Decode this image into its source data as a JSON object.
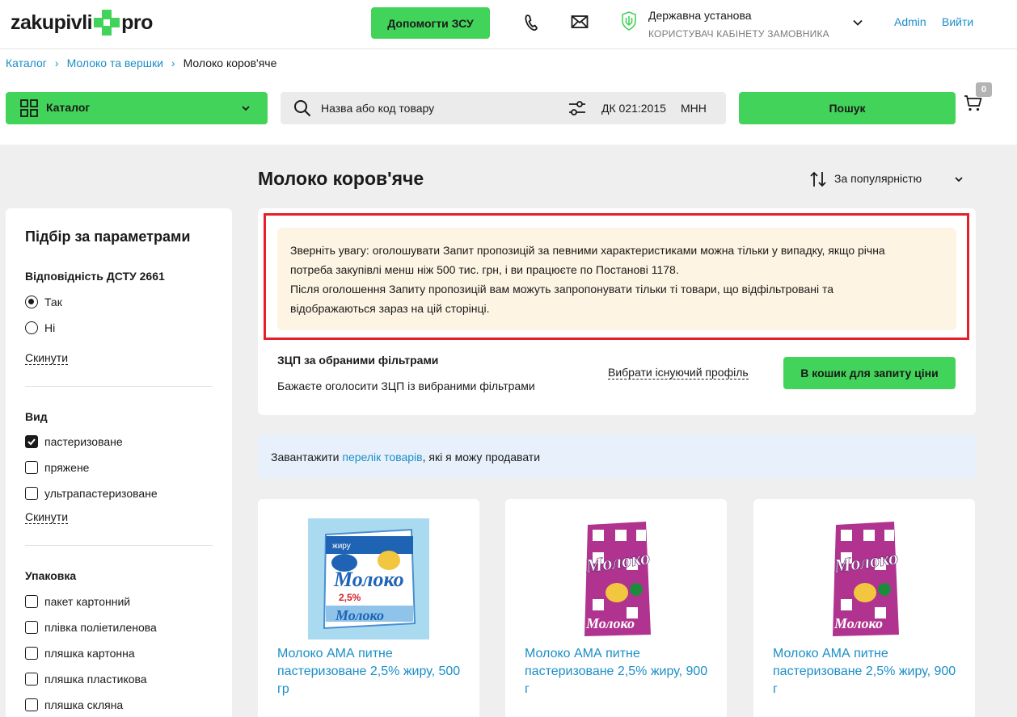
{
  "header": {
    "logo_left": "zakupivli",
    "logo_right": "pro",
    "help_button": "Допомогти ЗСУ",
    "org_name": "Державна установа",
    "org_role": "КОРИСТУВАЧ КАБІНЕТУ ЗАМОВНИКА",
    "admin_link": "Admin",
    "exit_link": "Вийти"
  },
  "breadcrumb": {
    "items": [
      "Каталог",
      "Молоко та вершки"
    ],
    "current": "Молоко коров'яче"
  },
  "search": {
    "catalog_label": "Каталог",
    "placeholder": "Назва або код товару",
    "option_dk": "ДК 021:2015",
    "option_mnn": "МНН",
    "button": "Пошук",
    "cart_count": "0"
  },
  "page": {
    "title": "Молоко коров'яче",
    "sort_label": "За популярністю"
  },
  "sidebar": {
    "title": "Підбір за параметрами",
    "groups": [
      {
        "title": "Відповідність ДСТУ 2661",
        "type": "radio",
        "options": [
          {
            "label": "Так",
            "checked": true
          },
          {
            "label": "Ні",
            "checked": false
          }
        ],
        "reset": "Скинути"
      },
      {
        "title": "Вид",
        "type": "checkbox",
        "options": [
          {
            "label": "пастеризоване",
            "checked": true
          },
          {
            "label": "пряжене",
            "checked": false
          },
          {
            "label": "ультрапастеризоване",
            "checked": false
          }
        ],
        "reset": "Скинути"
      },
      {
        "title": "Упаковка",
        "type": "checkbox",
        "options": [
          {
            "label": "пакет картонний",
            "checked": false
          },
          {
            "label": "плівка поліетиленова",
            "checked": false
          },
          {
            "label": "пляшка картонна",
            "checked": false
          },
          {
            "label": "пляшка пластикова",
            "checked": false
          },
          {
            "label": "пляшка скляна",
            "checked": false
          }
        ]
      }
    ]
  },
  "notice": {
    "line1": "Зверніть увагу: оголошувати Запит пропозицій за певними характеристиками можна тільки у випадку, якщо річна",
    "line2": "потреба закупівлі менш ніж 500 тис. грн, і ви працюєте по Постанові 1178.",
    "line3": "Після оголошення Запиту пропозицій вам можуть запропонувати тільки ті товари, що відфільтровані та",
    "line4": "відображаються зараз на цій сторінці.",
    "zcp_title": "ЗЦП за обраними фільтрами",
    "zcp_subtitle": "Бажаєте оголосити ЗЦП із вибраними фільтрами",
    "zcp_profile_link": "Вибрати існуючий профіль",
    "zcp_button": "В кошик для запиту ціни"
  },
  "info_banner": {
    "prefix": "Завантажити ",
    "link": "перелік товарів",
    "suffix": ", які я можу продавати"
  },
  "products": [
    {
      "name": "Молоко АМА питне пастеризоване 2,5% жиру, 500 гр",
      "image": "milk-pack-blue"
    },
    {
      "name": "Молоко АМА питне пастеризоване 2,5% жиру, 900 г",
      "image": "milk-pack-purple"
    },
    {
      "name": "Молоко АМА питне пастеризоване 2,5% жиру, 900 г",
      "image": "milk-pack-purple"
    }
  ],
  "colors": {
    "accent_green": "#42d45a",
    "link_blue": "#1a8ec7",
    "highlight_red": "#e3202a",
    "notice_bg": "#fdf4e3"
  }
}
